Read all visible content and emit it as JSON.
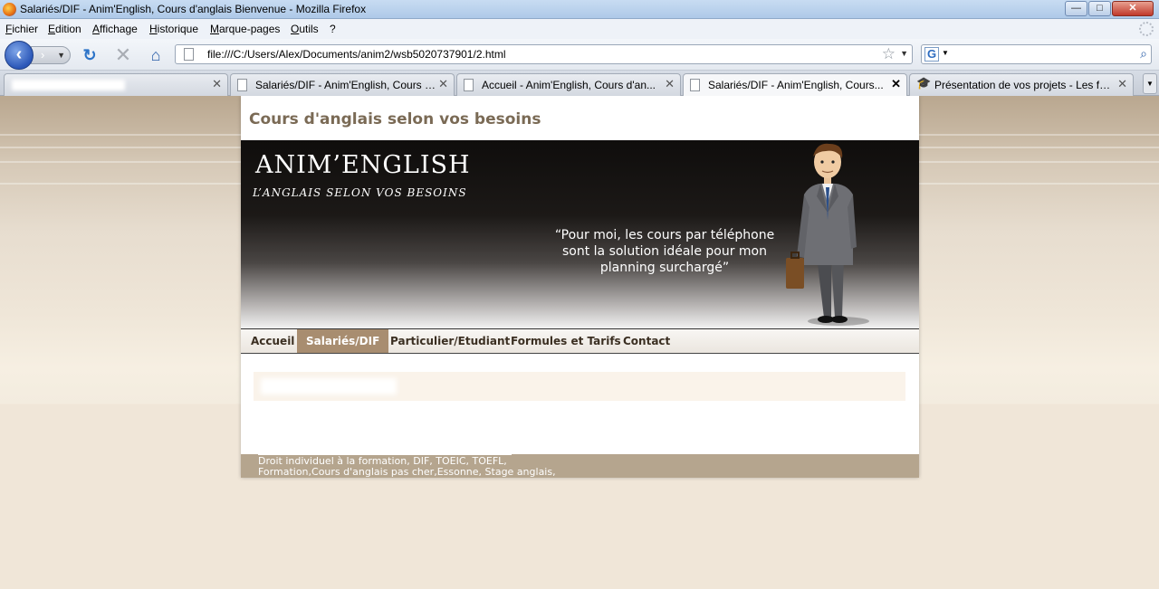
{
  "window": {
    "title": "Salariés/DIF - Anim'English, Cours d'anglais Bienvenue - Mozilla Firefox",
    "min_glyph": "—",
    "max_glyph": "□",
    "close_glyph": "✕"
  },
  "menu": {
    "items": [
      "Fichier",
      "Edition",
      "Affichage",
      "Historique",
      "Marque-pages",
      "Outils",
      "?"
    ]
  },
  "toolbar": {
    "back_glyph": "‹",
    "forward_glyph": "›",
    "reload_glyph": "↻",
    "stop_glyph": "✕",
    "home_glyph": "⌂",
    "url": "file:///C:/Users/Alex/Documents/anim2/wsb5020737901/2.html",
    "star_glyph": "☆",
    "search_engine_glyph": "G",
    "search_value": "",
    "search_glyph": "⌕"
  },
  "tabs": [
    {
      "label": "",
      "active": false
    },
    {
      "label": "Salariés/DIF - Anim'English, Cours d...",
      "active": false
    },
    {
      "label": "Accueil - Anim'English, Cours d'an...",
      "active": false
    },
    {
      "label": "Salariés/DIF - Anim'English, Cours...",
      "active": true
    },
    {
      "label": "Présentation de vos projets - Les for...",
      "active": false
    }
  ],
  "page": {
    "tagline": "Cours d'anglais selon vos besoins",
    "brand": "ANIM’ENGLISH",
    "subbrand": "L’ANGLAIS SELON VOS BESOINS",
    "quote": "“Pour moi, les cours par téléphone sont la solution idéale pour mon planning surchargé”",
    "nav": [
      "Accueil",
      "Salariés/DIF",
      "Particulier/Etudiant",
      "Formules et Tarifs",
      "Contact"
    ],
    "active_nav": "Salariés/DIF",
    "footer_line1": "Droit individuel à la formation, DIF, TOEIC, TOEFL,",
    "footer_line2": "Formation,Cours d'anglais pas cher,Essonne, Stage anglais,"
  },
  "colors": {
    "accent_nav": "#a88d70",
    "footer_bg": "#b5a58e",
    "tagline": "#7a6a55"
  }
}
